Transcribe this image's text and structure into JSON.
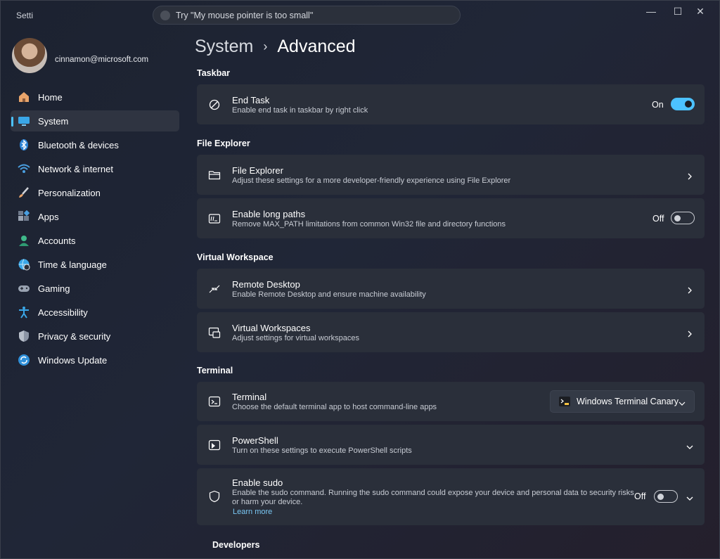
{
  "window": {
    "app_title": "Setti",
    "search_placeholder": "Try \"My mouse pointer is too small\"",
    "minimize": "—",
    "maximize": "☐",
    "close": "✕"
  },
  "profile": {
    "email": "cinnamon@microsoft.com"
  },
  "sidebar": {
    "items": [
      {
        "label": "Home",
        "icon": "home-icon"
      },
      {
        "label": "System",
        "icon": "system-icon",
        "active": true
      },
      {
        "label": "Bluetooth & devices",
        "icon": "bluetooth-icon"
      },
      {
        "label": "Network & internet",
        "icon": "wifi-icon"
      },
      {
        "label": "Personalization",
        "icon": "brush-icon"
      },
      {
        "label": "Apps",
        "icon": "apps-icon"
      },
      {
        "label": "Accounts",
        "icon": "account-icon"
      },
      {
        "label": "Time & language",
        "icon": "globe-clock-icon"
      },
      {
        "label": "Gaming",
        "icon": "gamepad-icon"
      },
      {
        "label": "Accessibility",
        "icon": "accessibility-icon"
      },
      {
        "label": "Privacy & security",
        "icon": "shield-icon"
      },
      {
        "label": "Windows Update",
        "icon": "update-icon"
      }
    ]
  },
  "breadcrumb": {
    "parent": "System",
    "current": "Advanced"
  },
  "sections": {
    "taskbar": "Taskbar",
    "file_explorer": "File Explorer",
    "virtual_workspace": "Virtual Workspace",
    "terminal": "Terminal",
    "developers": "Developers"
  },
  "cards": {
    "end_task": {
      "title": "End Task",
      "sub": "Enable end task in taskbar by right click",
      "state": "On"
    },
    "file_explorer": {
      "title": "File Explorer",
      "sub": "Adjust these settings for a more developer-friendly experience using File Explorer"
    },
    "long_paths": {
      "title": "Enable long paths",
      "sub": "Remove MAX_PATH limitations from common Win32 file and directory functions",
      "state": "Off"
    },
    "remote_desktop": {
      "title": "Remote Desktop",
      "sub": "Enable Remote Desktop and ensure machine availability"
    },
    "virtual_workspaces": {
      "title": "Virtual Workspaces",
      "sub": "Adjust settings for virtual workspaces"
    },
    "terminal": {
      "title": "Terminal",
      "sub": "Choose the default terminal app to host command-line apps",
      "selected": "Windows Terminal Canary"
    },
    "powershell": {
      "title": "PowerShell",
      "sub": "Turn on these settings to execute PowerShell scripts"
    },
    "sudo": {
      "title": "Enable sudo",
      "sub1": "Enable the sudo command. Running the sudo command could expose your device and personal data to security risks",
      "sub2": "or harm your device.",
      "link": "Learn more",
      "state": "Off"
    }
  },
  "colors": {
    "accent": "#4cc2ff",
    "card": "#2a2f3a",
    "link": "#79c6f2"
  }
}
